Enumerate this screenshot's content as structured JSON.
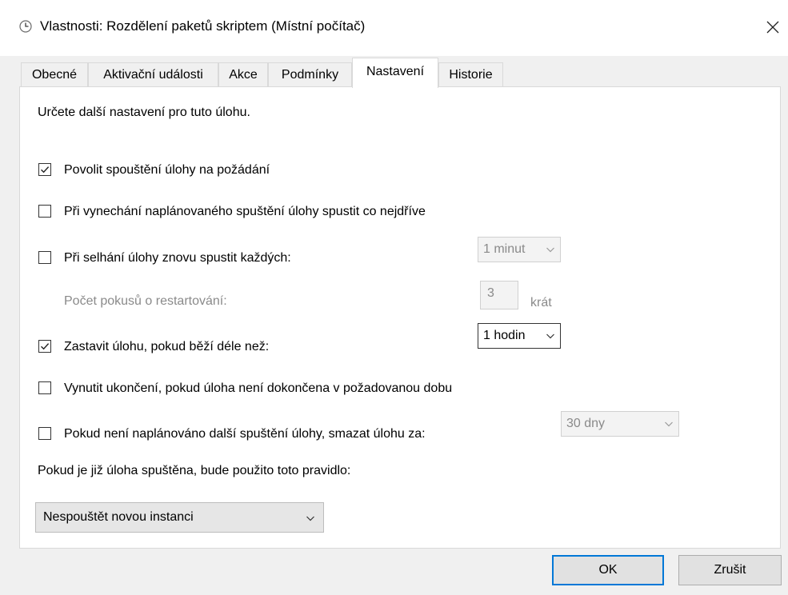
{
  "window": {
    "title": "Vlastnosti: Rozdělení paketů skriptem (Místní počítač)",
    "icon": "clock-icon",
    "close_icon": "close-icon"
  },
  "tabs": [
    {
      "label": "Obecné",
      "active": false
    },
    {
      "label": "Aktivační události",
      "active": false
    },
    {
      "label": "Akce",
      "active": false
    },
    {
      "label": "Podmínky",
      "active": false
    },
    {
      "label": "Nastavení",
      "active": true
    },
    {
      "label": "Historie",
      "active": false
    }
  ],
  "settings": {
    "intro": "Určete další nastavení pro tuto úlohu.",
    "allow_on_demand": {
      "label": "Povolit spouštění úlohy na požádání",
      "checked": true
    },
    "run_asap_missed": {
      "label": "Při vynechání naplánovaného spuštění úlohy spustit co nejdříve",
      "checked": false
    },
    "restart_on_fail": {
      "label": "Při selhání úlohy znovu spustit každých:",
      "checked": false,
      "interval": "1 minut"
    },
    "restart_attempts": {
      "label": "Počet pokusů o restartování:",
      "value": "3",
      "unit": "krát"
    },
    "stop_if_longer": {
      "label": "Zastavit úlohu, pokud běží déle než:",
      "checked": true,
      "duration": "1 hodin"
    },
    "force_stop": {
      "label": "Vynutit ukončení, pokud úloha není dokončena v požadovanou dobu",
      "checked": false
    },
    "delete_if_not_scheduled": {
      "label": "Pokud není naplánováno další spuštění úlohy, smazat úlohu za:",
      "checked": false,
      "after": "30 dny"
    },
    "running_rule_label": "Pokud je již úloha spuštěna, bude použito toto pravidlo:",
    "running_rule_value": "Nespouštět novou instanci"
  },
  "buttons": {
    "ok": "OK",
    "cancel": "Zrušit"
  },
  "colors": {
    "accent": "#0078d7",
    "panel_bg": "#ffffff",
    "window_bg": "#f0f0f0",
    "disabled_text": "#8a8a8a"
  }
}
